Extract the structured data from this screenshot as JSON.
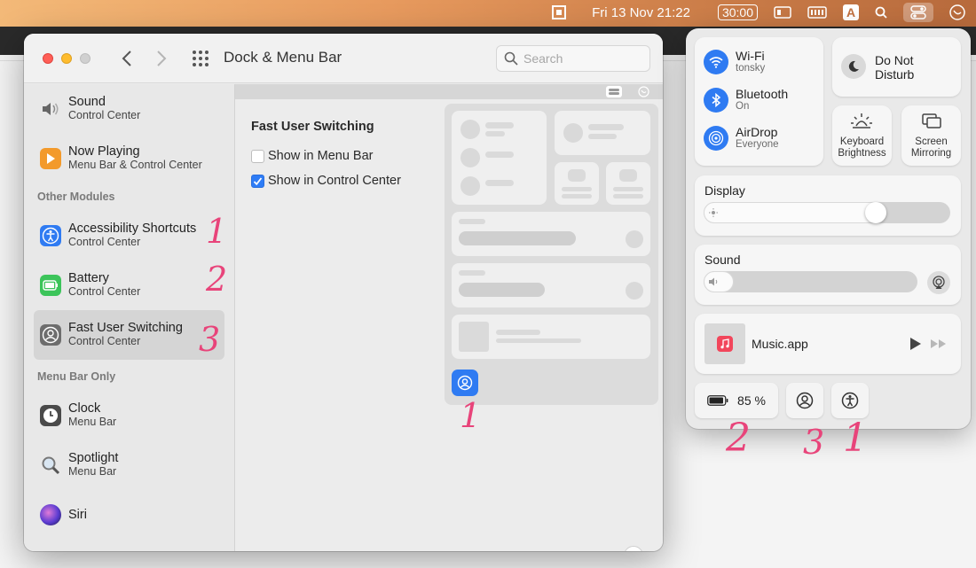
{
  "menubar": {
    "datetime": "Fri 13 Nov 21:22",
    "timer": "30:00",
    "input_source": "A"
  },
  "window": {
    "title": "Dock & Menu Bar",
    "search_placeholder": "Search"
  },
  "sidebar": {
    "items_top": [
      {
        "name": "Sound",
        "sub": "Control Center"
      },
      {
        "name": "Now Playing",
        "sub": "Menu Bar & Control Center"
      }
    ],
    "header_other": "Other Modules",
    "items_other": [
      {
        "name": "Accessibility Shortcuts",
        "sub": "Control Center"
      },
      {
        "name": "Battery",
        "sub": "Control Center"
      },
      {
        "name": "Fast User Switching",
        "sub": "Control Center"
      }
    ],
    "header_menubar": "Menu Bar Only",
    "items_menubar": [
      {
        "name": "Clock",
        "sub": "Menu Bar"
      },
      {
        "name": "Spotlight",
        "sub": "Menu Bar"
      },
      {
        "name": "Siri",
        "sub": ""
      }
    ]
  },
  "content": {
    "title": "Fast User Switching",
    "options": [
      {
        "label": "Show in Menu Bar",
        "checked": false
      },
      {
        "label": "Show in Control Center",
        "checked": true
      }
    ],
    "help": "?"
  },
  "control_center": {
    "wifi": {
      "name": "Wi-Fi",
      "sub": "tonsky"
    },
    "bluetooth": {
      "name": "Bluetooth",
      "sub": "On"
    },
    "airdrop": {
      "name": "AirDrop",
      "sub": "Everyone"
    },
    "dnd": "Do Not\nDisturb",
    "keyboard_brightness": "Keyboard\nBrightness",
    "screen_mirroring": "Screen\nMirroring",
    "display_label": "Display",
    "display_level": 0.74,
    "sound_label": "Sound",
    "sound_level": 0.14,
    "now_playing": "Music.app",
    "battery": "85 %"
  },
  "annotations": {
    "sidebar": [
      "1",
      "2",
      "3"
    ],
    "preview": "1",
    "control_center": [
      "2",
      "3",
      "1"
    ]
  },
  "colors": {
    "accent": "#2f7bf2",
    "annotation": "#e8447a"
  }
}
